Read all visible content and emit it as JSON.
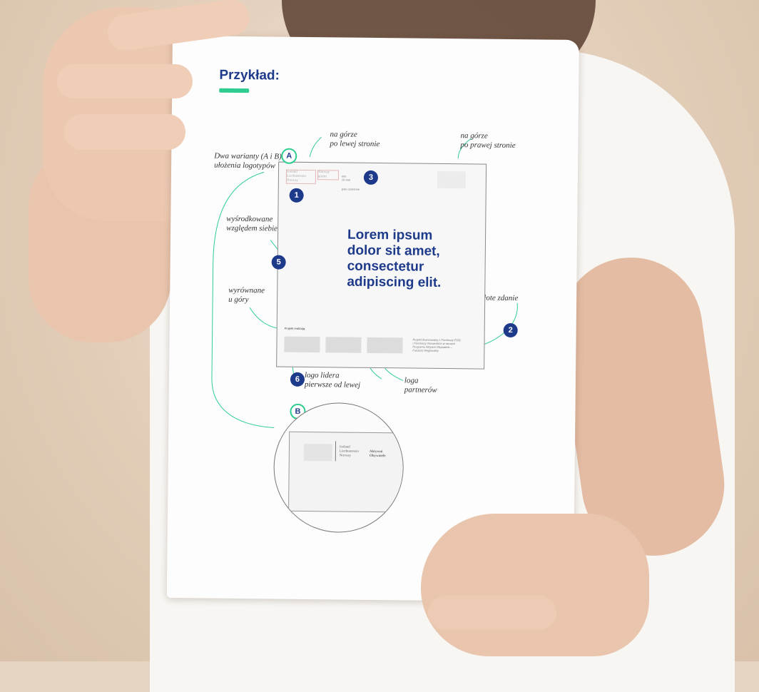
{
  "doc": {
    "heading": "Przykład:",
    "note_top_left": "na górze\npo lewej stronie",
    "note_top_right": "na górze\npo prawej stronie",
    "note_variants": "Dwa warianty (A i B)\nułożenia logotypów",
    "note_centered": "wyśrodkowane\nwzględem siebie",
    "note_aligned": "wyrównane\nu góry",
    "note_gold": "Złote zdanie",
    "note_leader": "logo lidera\npierwsze od lewej",
    "note_partners": "loga\npartnerów",
    "badge_a": "A",
    "badge_b": "B",
    "badge_1": "1",
    "badge_2": "2",
    "badge_3": "3",
    "badge_5": "5",
    "badge_6": "6",
    "min_label": "min.\n10 mm",
    "safe_label": "pole ochronne",
    "headline": "Lorem ipsum\ndolor sit amet,\nconsectetur\nadipiscing elit.",
    "project_label": "Projekt realizują:",
    "funding_text": "Projekt finansowany z Funduszy EOG\ni Funduszy Norweskich w ramach\nProgramu Aktywni Obywatele –\nFundusz Regionalny",
    "logo_iceland": "Iceland\nLiechtenstein\nNorway",
    "logo_norway": "Norway\ngrants",
    "logo_active": "Aktywni\nObywatele"
  },
  "colors": {
    "accent_blue": "#1e3a8a",
    "accent_green": "#2ecc8f"
  }
}
